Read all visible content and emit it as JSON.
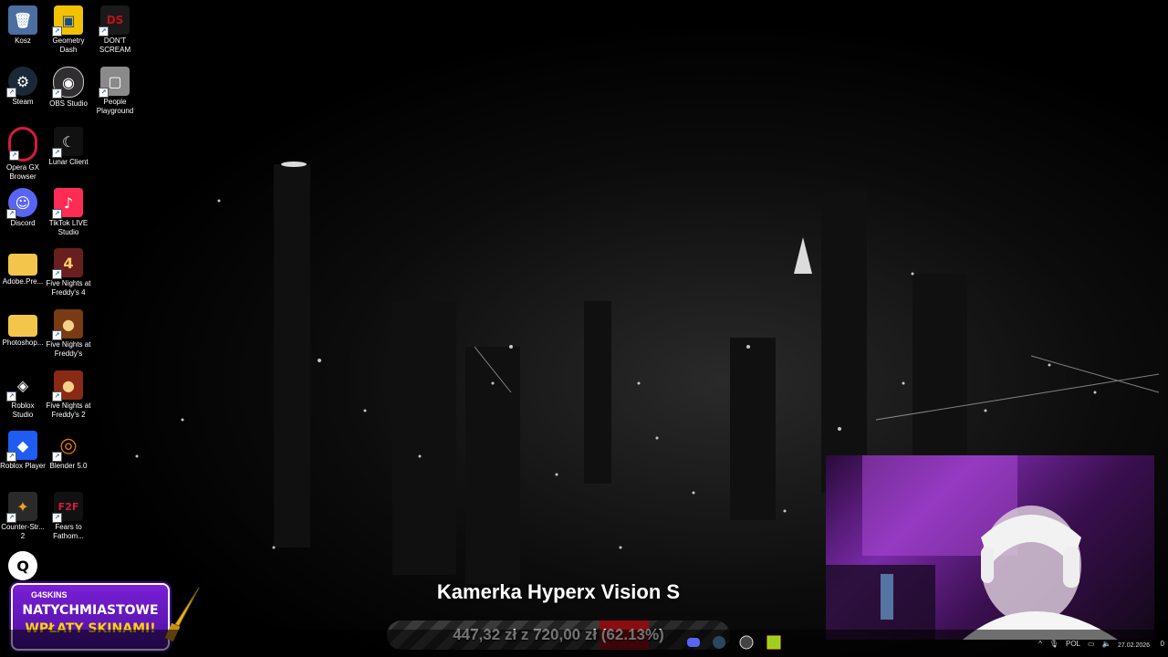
{
  "desktop_icons": [
    {
      "label": "Kosz",
      "icon": "recycle-bin-icon",
      "color": "#5a8fd0"
    },
    {
      "label": "Geometry\nDash",
      "icon": "geometry-dash-icon",
      "color": "#f2c200"
    },
    {
      "label": "DON'T\nSCREAM",
      "icon": "dont-scream-icon",
      "color": "#1a1a1a"
    },
    {
      "label": "Steam",
      "icon": "steam-icon",
      "color": "#1b2838"
    },
    {
      "label": "OBS Studio",
      "icon": "obs-icon",
      "color": "#302e31"
    },
    {
      "label": "People\nPlayground",
      "icon": "people-playground-icon",
      "color": "#8a8a8a"
    },
    {
      "label": "Opera GX\nBrowser",
      "icon": "opera-gx-icon",
      "color": "#d51b3a"
    },
    {
      "label": "Lunar Client",
      "icon": "lunar-client-icon",
      "color": "#222222"
    },
    {
      "label": "Discord",
      "icon": "discord-icon",
      "color": "#5865f2"
    },
    {
      "label": "TikTok LIVE\nStudio",
      "icon": "tiktok-icon",
      "color": "#fe2c55"
    },
    {
      "label": "Adobe.Pre...",
      "icon": "folder-icon",
      "color": "#f3c54a"
    },
    {
      "label": "Five Nights at\nFreddy's 4",
      "icon": "fnaf4-icon",
      "color": "#6a1f1f"
    },
    {
      "label": "Photoshop...",
      "icon": "folder-icon",
      "color": "#f3c54a"
    },
    {
      "label": "Five Nights at\nFreddy's",
      "icon": "fnaf-icon",
      "color": "#7a3b14"
    },
    {
      "label": "Roblox\nStudio",
      "icon": "roblox-studio-icon",
      "color": "#1a1a1a"
    },
    {
      "label": "Five Nights at\nFreddy's 2",
      "icon": "fnaf2-icon",
      "color": "#8a2a14"
    },
    {
      "label": "Roblox Player",
      "icon": "roblox-icon",
      "color": "#1e5cf2"
    },
    {
      "label": "Blender 5.0",
      "icon": "blender-icon",
      "color": "#e87d0d"
    },
    {
      "label": "Counter-Str...\n2",
      "icon": "cs2-icon",
      "color": "#f0a020"
    },
    {
      "label": "Fears to\nFathom...",
      "icon": "fears-to-fathom-icon",
      "color": "#111111"
    },
    {
      "label": "",
      "icon": "search-app-icon",
      "color": "#0a0a0a"
    }
  ],
  "overlay": {
    "title": "Kamerka Hyperx Vision S",
    "goal_text": "447,32 zł z 720,00 zł (62.13%)",
    "goal_fraction": 0.6213
  },
  "promo": {
    "brand": "G4SKINS",
    "line1": "NATYCHMIASTOWE",
    "line2": "WPŁATY SKINAMI!"
  },
  "tray": {
    "language": "POL",
    "date": "27.02.2026",
    "notification_count": "0"
  },
  "colors": {
    "goal_accent": "#8a0d12",
    "promo_bg": "#5a17b8",
    "promo_text_yellow": "#ffd400"
  }
}
